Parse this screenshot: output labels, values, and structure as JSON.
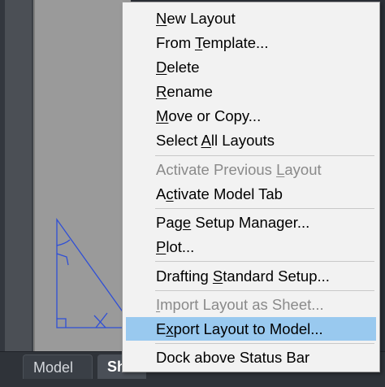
{
  "tabs": [
    {
      "label": "Model"
    },
    {
      "label": "Sh"
    }
  ],
  "menu": {
    "items": [
      {
        "pre": "",
        "key": "N",
        "post": "ew Layout"
      },
      {
        "pre": "From ",
        "key": "T",
        "post": "emplate..."
      },
      {
        "pre": "",
        "key": "D",
        "post": "elete"
      },
      {
        "pre": "",
        "key": "R",
        "post": "ename"
      },
      {
        "pre": "",
        "key": "M",
        "post": "ove or Copy..."
      },
      {
        "pre": "Select ",
        "key": "A",
        "post": "ll Layouts"
      },
      {
        "pre": "Activate Previous ",
        "key": "L",
        "post": "ayout"
      },
      {
        "pre": "A",
        "key": "c",
        "post": "tivate Model Tab"
      },
      {
        "pre": "Pag",
        "key": "e",
        "post": " Setup Manager..."
      },
      {
        "pre": "",
        "key": "P",
        "post": "lot..."
      },
      {
        "pre": "Drafting ",
        "key": "S",
        "post": "tandard Setup..."
      },
      {
        "pre": "",
        "key": "I",
        "post": "mport Layout as Sheet..."
      },
      {
        "pre": "E",
        "key": "x",
        "post": "port Layout to Model..."
      },
      {
        "pre": "Dock above Status Bar",
        "key": "",
        "post": ""
      }
    ]
  },
  "colors": {
    "highlight": "#99c9ef",
    "disabled_text": "#8a8a8a",
    "drawing_stroke": "#2f4fd6"
  }
}
